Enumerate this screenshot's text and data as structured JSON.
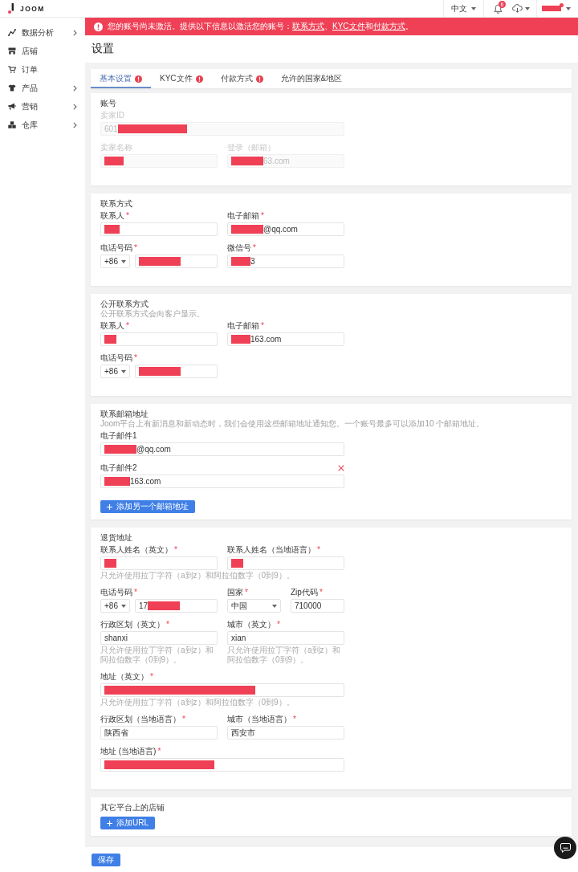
{
  "header": {
    "logo": "JOOM",
    "language": "中文",
    "notification_count": "6",
    "user": {
      "parts": [
        {
          "kind": "shortbar"
        }
      ],
      "alert_dot": true
    }
  },
  "sidebar": {
    "items": [
      {
        "label": "数据分析",
        "expandable": true
      },
      {
        "label": "店铺",
        "expandable": false
      },
      {
        "label": "订单",
        "expandable": false
      },
      {
        "label": "产品",
        "expandable": true
      },
      {
        "label": "营销",
        "expandable": true
      },
      {
        "label": "仓库",
        "expandable": true
      }
    ]
  },
  "alert": {
    "parts": [
      {
        "kind": "text",
        "text": "您的账号尚未激活。提供以下信息以激活您的账号："
      },
      {
        "kind": "link",
        "text": "联系方式"
      },
      {
        "kind": "text",
        "text": "、"
      },
      {
        "kind": "link",
        "text": "KYC文件"
      },
      {
        "kind": "text",
        "text": "和"
      },
      {
        "kind": "link",
        "text": "付款方式"
      },
      {
        "kind": "text",
        "text": "。"
      }
    ]
  },
  "page_title": "设置",
  "tabs": [
    {
      "label": "基本设置",
      "selected": true,
      "warning": true
    },
    {
      "label": "KYC文件",
      "selected": false,
      "warning": true
    },
    {
      "label": "付款方式",
      "selected": false,
      "warning": true
    },
    {
      "label": "允许的国家&地区",
      "selected": false,
      "warning": false
    }
  ],
  "sections": [
    {
      "title": "账号",
      "rows": [
        [
          {
            "kind": "wide",
            "label": "卖家ID",
            "disabled": true,
            "value_parts": [
              {
                "kind": "text",
                "text": "601"
              },
              {
                "kind": "longerbar"
              }
            ]
          }
        ],
        [
          {
            "kind": "text",
            "label": "卖家名称",
            "disabled": true,
            "value_parts": [
              {
                "kind": "shortbar"
              }
            ]
          },
          {
            "kind": "text",
            "label": "登录（邮箱）",
            "disabled": true,
            "value_parts": [
              {
                "kind": "mediumbar"
              },
              {
                "kind": "text",
                "text": "63.com"
              }
            ]
          }
        ]
      ]
    },
    {
      "title": "联系方式",
      "rows": [
        [
          {
            "kind": "text",
            "label": "联系人",
            "required_mark": "*",
            "disabled": false,
            "value_parts": [
              {
                "kind": "smallbar"
              }
            ]
          },
          {
            "kind": "text",
            "label": "电子邮箱",
            "required_mark": "*",
            "disabled": false,
            "value_parts": [
              {
                "kind": "mediumbar"
              },
              {
                "kind": "text",
                "text": "@qq.com"
              }
            ]
          }
        ],
        [
          {
            "kind": "phone",
            "label": "电话号码",
            "required_mark": "*",
            "disabled": false,
            "code": "+86",
            "value_parts": [
              {
                "kind": "longbar"
              }
            ]
          },
          {
            "kind": "text",
            "label": "微信号",
            "required_mark": "*",
            "disabled": false,
            "value_parts": [
              {
                "kind": "shortbar"
              },
              {
                "kind": "text",
                "text": "3"
              }
            ]
          }
        ]
      ]
    },
    {
      "title": "公开联系方式",
      "subtitle": "公开联系方式会向客户显示。",
      "rows": [
        [
          {
            "kind": "text",
            "label": "联系人",
            "required_mark": "*",
            "disabled": false,
            "value_parts": [
              {
                "kind": "tinybar"
              }
            ]
          },
          {
            "kind": "text",
            "label": "电子邮箱",
            "required_mark": "*",
            "disabled": false,
            "value_parts": [
              {
                "kind": "shortbar"
              },
              {
                "kind": "text",
                "text": "163.com"
              }
            ]
          }
        ],
        [
          {
            "kind": "phone",
            "label": "电话号码",
            "required_mark": "*",
            "disabled": false,
            "code": "+86",
            "value_parts": [
              {
                "kind": "longbar"
              }
            ]
          }
        ]
      ]
    },
    {
      "title": "联系邮箱地址",
      "subtitle": "Joom平台上有新消息和新动态时，我们会使用这些邮箱地址通知您。一个账号最多可以添加10 个邮箱地址。",
      "rows": [
        [
          {
            "kind": "wide",
            "label": "电子邮件1",
            "disabled": false,
            "removable": false,
            "value_parts": [
              {
                "kind": "mediumbar"
              },
              {
                "kind": "text",
                "text": "@qq.com"
              }
            ]
          }
        ],
        [
          {
            "kind": "wide",
            "label": "电子邮件2",
            "disabled": false,
            "removable": true,
            "value_parts": [
              {
                "kind": "compactbar"
              },
              {
                "kind": "text",
                "text": "163.com"
              }
            ]
          }
        ]
      ],
      "button": "添加另一个邮箱地址"
    },
    {
      "title": "退货地址",
      "rows": [
        [
          {
            "kind": "text",
            "label": "联系人姓名（英文）",
            "required_mark": "*",
            "disabled": false,
            "value_parts": [
              {
                "kind": "tinybar"
              }
            ],
            "hint": "只允许使用拉丁字符（a到z）和阿拉伯数字（0到9）。"
          },
          {
            "kind": "text",
            "label": "联系人姓名（当地语言）",
            "required_mark": "*",
            "disabled": false,
            "value_parts": [
              {
                "kind": "tinybar"
              }
            ]
          }
        ],
        [
          {
            "kind": "phone",
            "label": "电话号码",
            "required_mark": "*",
            "disabled": false,
            "code": "+86",
            "value_parts": [
              {
                "kind": "text",
                "text": "17"
              },
              {
                "kind": "mediumbar"
              }
            ]
          },
          {
            "kind": "select",
            "label": "国家",
            "required_mark": "*",
            "disabled": false,
            "value": "中国"
          },
          {
            "kind": "text",
            "label": "Zip代码",
            "required_mark": "*",
            "disabled": false,
            "value": "710000"
          }
        ],
        [
          {
            "kind": "text",
            "label": "行政区划（英文）",
            "required_mark": "*",
            "disabled": false,
            "value": "shanxi",
            "hint": "只允许使用拉丁字符（a到z）和阿拉伯数字（0到9）。"
          },
          {
            "kind": "text",
            "label": "城市（英文）",
            "required_mark": "*",
            "disabled": false,
            "value": "xian",
            "hint": "只允许使用拉丁字符（a到z）和阿拉伯数字（0到9）。"
          }
        ],
        [
          {
            "kind": "wide",
            "label": "地址（英文）",
            "required_mark": "*",
            "disabled": false,
            "value_parts": [
              {
                "kind": "fullbar"
              }
            ],
            "hint": "只允许使用拉丁字符（a到z）和阿拉伯数字（0到9）。"
          }
        ],
        [
          {
            "kind": "text",
            "label": "行政区划（当地语言）",
            "required_mark": "*",
            "disabled": false,
            "value": "陕西省"
          },
          {
            "kind": "text",
            "label": "城市（当地语言）",
            "required_mark": "*",
            "disabled": false,
            "value": "西安市"
          }
        ],
        [
          {
            "kind": "wide",
            "label": "地址 (当地语言)",
            "required_mark": "*",
            "disabled": false,
            "value_parts": [
              {
                "kind": "hugebar"
              }
            ]
          }
        ]
      ]
    },
    {
      "title": "其它平台上的店铺",
      "button": "添加URL"
    }
  ],
  "save_button": "保存"
}
